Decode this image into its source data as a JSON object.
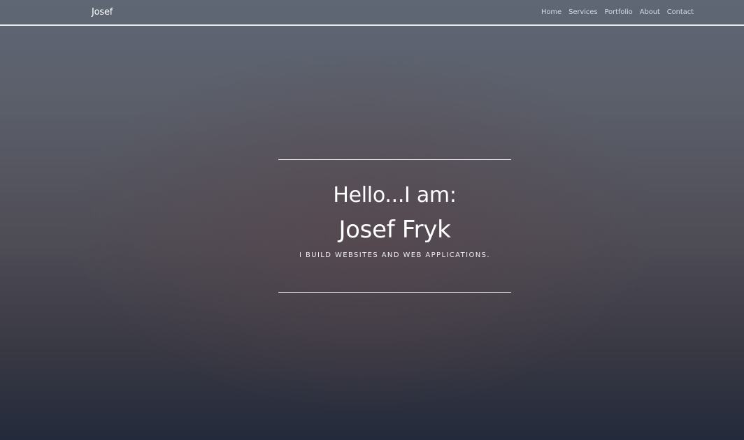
{
  "navbar": {
    "brand": "Josef",
    "links": [
      "Home",
      "Services",
      "Portfolio",
      "About",
      "Contact"
    ]
  },
  "hero": {
    "greeting": "Hello...I am:",
    "name": "Josef Fryk",
    "tagline": "I BUILD WEBSITES AND WEB APPLICATIONS."
  }
}
